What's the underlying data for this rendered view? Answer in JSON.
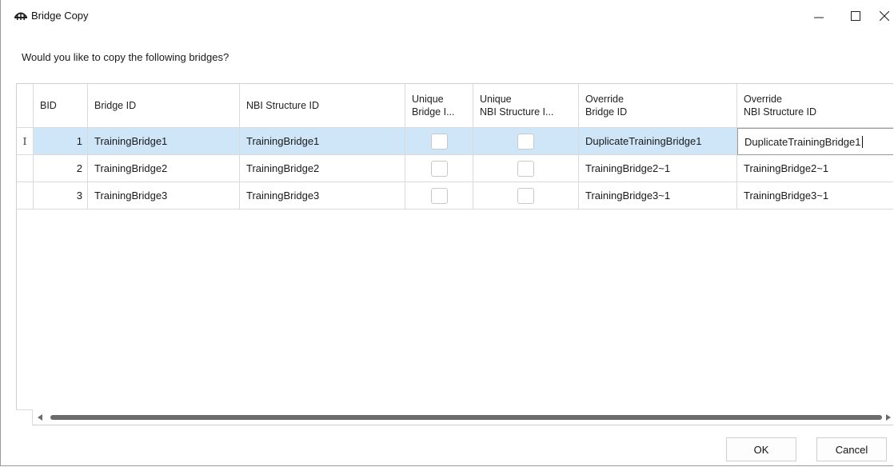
{
  "window": {
    "title": "Bridge Copy"
  },
  "prompt": "Would you like to copy the following bridges?",
  "grid": {
    "headers": {
      "bid": "BID",
      "bridge_id": "Bridge ID",
      "nbi_structure_id": "NBI Structure ID",
      "unique_bridge_line1": "Unique",
      "unique_bridge_line2": "Bridge I...",
      "unique_nbi_line1": "Unique",
      "unique_nbi_line2": "NBI Structure I...",
      "override_bridge_line1": "Override",
      "override_bridge_line2": "Bridge ID",
      "override_nbi_line1": "Override",
      "override_nbi_line2": "NBI Structure ID"
    },
    "rows": [
      {
        "bid": "1",
        "bridge_id": "TrainingBridge1",
        "nbi_structure_id": "TrainingBridge1",
        "unique_bridge_id": false,
        "unique_nbi_structure_id": false,
        "override_bridge_id": "DuplicateTrainingBridge1",
        "override_nbi_structure_id": "DuplicateTrainingBridge1",
        "selected": true
      },
      {
        "bid": "2",
        "bridge_id": "TrainingBridge2",
        "nbi_structure_id": "TrainingBridge2",
        "unique_bridge_id": false,
        "unique_nbi_structure_id": false,
        "override_bridge_id": "TrainingBridge2~1",
        "override_nbi_structure_id": "TrainingBridge2~1",
        "selected": false
      },
      {
        "bid": "3",
        "bridge_id": "TrainingBridge3",
        "nbi_structure_id": "TrainingBridge3",
        "unique_bridge_id": false,
        "unique_nbi_structure_id": false,
        "override_bridge_id": "TrainingBridge3~1",
        "override_nbi_structure_id": "TrainingBridge3~1",
        "selected": false
      }
    ],
    "row_header_glyph": "I"
  },
  "buttons": {
    "ok": "OK",
    "cancel": "Cancel"
  },
  "icons": {
    "app": "bridge-icon",
    "minimize": "minimize-icon",
    "maximize": "maximize-icon",
    "close": "close-icon",
    "scroll_left": "scroll-left-arrow-icon",
    "scroll_right": "scroll-right-arrow-icon"
  },
  "colors": {
    "selected_row": "#cfe6f8",
    "grid_line": "#dadada",
    "scroll_thumb": "#6b6b6b"
  }
}
